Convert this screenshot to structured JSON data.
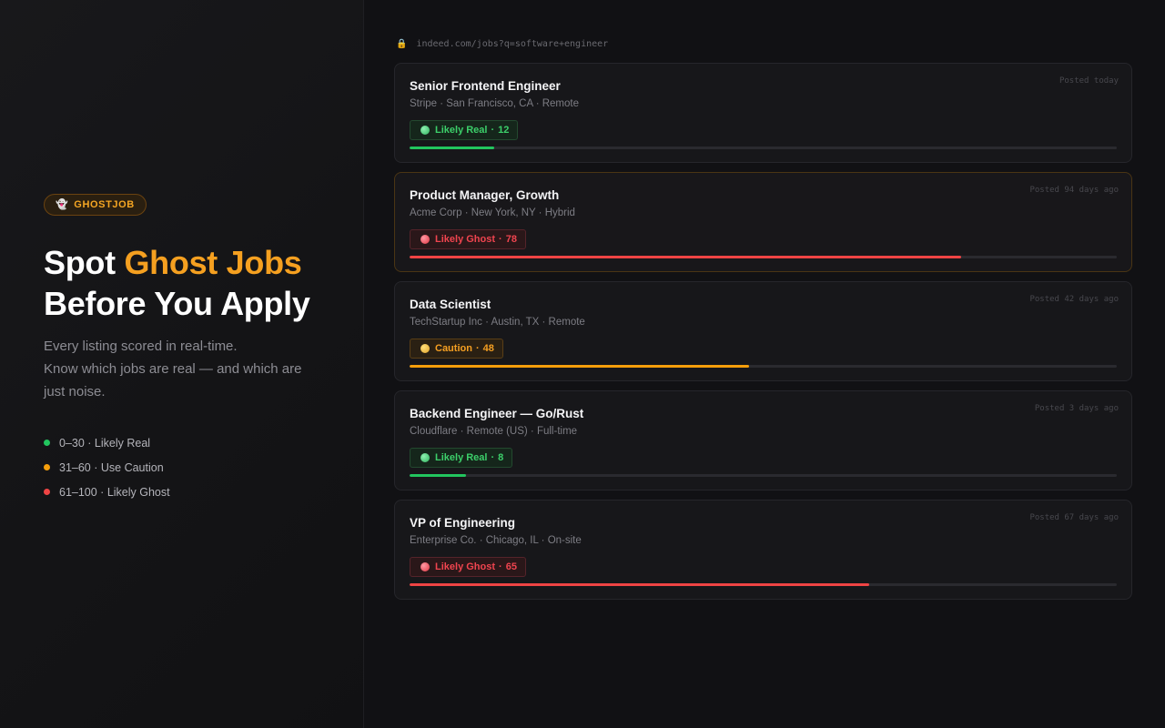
{
  "brand": {
    "badge_label": "GHOSTJOB",
    "badge_icon": "ghost-icon"
  },
  "hero": {
    "title_pre": "Spot ",
    "title_accent": "Ghost Jobs",
    "title_post": " Before You Apply",
    "subtitle_line1": "Every listing scored in real-time.",
    "subtitle_line2": "Know which jobs are real — and which are just noise."
  },
  "legend": [
    {
      "label": "0–30 · Likely Real",
      "color": "#22c55e"
    },
    {
      "label": "31–60 · Use Caution",
      "color": "#f59e0b"
    },
    {
      "label": "61–100 · Likely Ghost",
      "color": "#ef4444"
    }
  ],
  "url": {
    "icon": "lock-icon",
    "text": "indeed.com/jobs?q=software+engineer"
  },
  "colors": {
    "real": "#22c55e",
    "caution": "#f59e0b",
    "ghost": "#ef4444",
    "accent": "#f5a020"
  },
  "jobs": [
    {
      "title": "Senior Frontend Engineer",
      "meta": "Stripe · San Francisco, CA · Remote",
      "posted": "Posted today",
      "verdict": "Likely Real",
      "score": 12,
      "status": "real"
    },
    {
      "title": "Product Manager, Growth",
      "meta": "Acme Corp · New York, NY · Hybrid",
      "posted": "Posted 94 days ago",
      "verdict": "Likely Ghost",
      "score": 78,
      "status": "ghost"
    },
    {
      "title": "Data Scientist",
      "meta": "TechStartup Inc · Austin, TX · Remote",
      "posted": "Posted 42 days ago",
      "verdict": "Caution",
      "score": 48,
      "status": "caution"
    },
    {
      "title": "Backend Engineer — Go/Rust",
      "meta": "Cloudflare · Remote (US) · Full-time",
      "posted": "Posted 3 days ago",
      "verdict": "Likely Real",
      "score": 8,
      "status": "real"
    },
    {
      "title": "VP of Engineering",
      "meta": "Enterprise Co. · Chicago, IL · On-site",
      "posted": "Posted 67 days ago",
      "verdict": "Likely Ghost",
      "score": 65,
      "status": "ghost"
    }
  ]
}
